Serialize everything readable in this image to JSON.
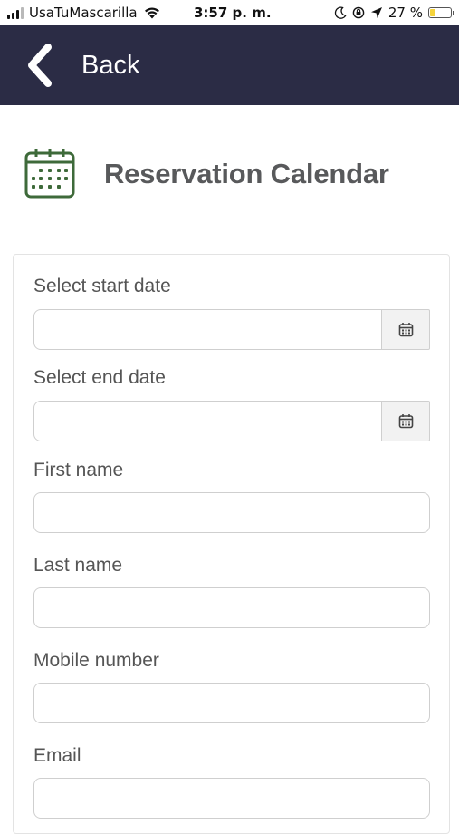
{
  "status_bar": {
    "carrier": "UsaTuMascarilla",
    "time": "3:57 p. m.",
    "battery_percent_text": "27 %",
    "battery_level": 0.27,
    "battery_color": "#f5d33b",
    "icons": [
      "signal-icon",
      "wifi-icon",
      "moon-icon",
      "lock-rotation-icon",
      "location-arrow-icon",
      "battery-icon"
    ]
  },
  "header": {
    "back_label": "Back",
    "background": "#2b2c45"
  },
  "page": {
    "title": "Reservation Calendar",
    "icon": "calendar-icon",
    "icon_color": "#3e6a3a"
  },
  "form": {
    "start_date": {
      "label": "Select start date",
      "value": "",
      "addon_icon": "calendar-small-icon"
    },
    "end_date": {
      "label": "Select end date",
      "value": "",
      "addon_icon": "calendar-small-icon"
    },
    "first_name": {
      "label": "First name",
      "value": ""
    },
    "last_name": {
      "label": "Last name",
      "value": ""
    },
    "mobile_number": {
      "label": "Mobile number",
      "value": ""
    },
    "email": {
      "label": "Email",
      "value": ""
    }
  }
}
